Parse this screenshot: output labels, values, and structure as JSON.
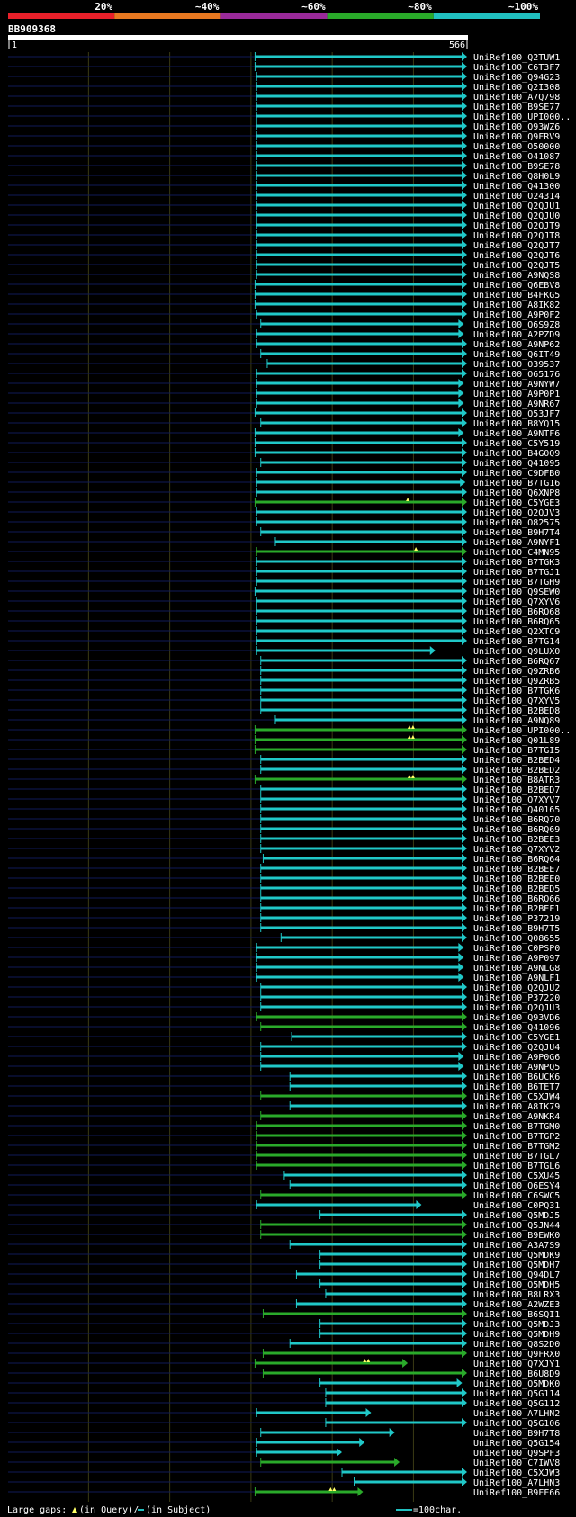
{
  "chart_data": {
    "type": "alignment-overview",
    "query_id": "BB909368",
    "query_range": [
      1,
      566
    ],
    "start_label": "1",
    "end_label": "566",
    "identity_scale": [
      {
        "label": "20%",
        "color": "#e8202a"
      },
      {
        "label": "~40%",
        "color": "#e87820"
      },
      {
        "label": "~60%",
        "color": "#9a2a9a"
      },
      {
        "label": "~80%",
        "color": "#2aaa2a"
      },
      {
        "label": "~100%",
        "color": "#20c0c0"
      }
    ],
    "hits": [
      {
        "id": "UniRef100_Q2TUW1",
        "start": 305,
        "end": 566,
        "c": "c"
      },
      {
        "id": "UniRef100_C6T3F7",
        "start": 305,
        "end": 566,
        "c": "c"
      },
      {
        "id": "UniRef100_Q94G23",
        "start": 307,
        "end": 566,
        "c": "c"
      },
      {
        "id": "UniRef100_Q2I308",
        "start": 307,
        "end": 566,
        "c": "c"
      },
      {
        "id": "UniRef100_A7Q798",
        "start": 307,
        "end": 566,
        "c": "c"
      },
      {
        "id": "UniRef100_B9SE77",
        "start": 307,
        "end": 566,
        "c": "c"
      },
      {
        "id": "UniRef100_UPI000..",
        "start": 307,
        "end": 566,
        "c": "c"
      },
      {
        "id": "UniRef100_Q93WZ6",
        "start": 307,
        "end": 566,
        "c": "c"
      },
      {
        "id": "UniRef100_Q9FRV9",
        "start": 307,
        "end": 566,
        "c": "c"
      },
      {
        "id": "UniRef100_O50000",
        "start": 307,
        "end": 566,
        "c": "c"
      },
      {
        "id": "UniRef100_O41087",
        "start": 307,
        "end": 566,
        "c": "c"
      },
      {
        "id": "UniRef100_B9SE78",
        "start": 307,
        "end": 566,
        "c": "c"
      },
      {
        "id": "UniRef100_Q8H0L9",
        "start": 307,
        "end": 566,
        "c": "c"
      },
      {
        "id": "UniRef100_Q41300",
        "start": 307,
        "end": 566,
        "c": "c"
      },
      {
        "id": "UniRef100_O24314",
        "start": 307,
        "end": 566,
        "c": "c"
      },
      {
        "id": "UniRef100_Q2QJU1",
        "start": 307,
        "end": 566,
        "c": "c"
      },
      {
        "id": "UniRef100_Q2QJU0",
        "start": 307,
        "end": 566,
        "c": "c"
      },
      {
        "id": "UniRef100_Q2QJT9",
        "start": 307,
        "end": 566,
        "c": "c"
      },
      {
        "id": "UniRef100_Q2QJT8",
        "start": 307,
        "end": 566,
        "c": "c"
      },
      {
        "id": "UniRef100_Q2QJT7",
        "start": 307,
        "end": 566,
        "c": "c"
      },
      {
        "id": "UniRef100_Q2QJT6",
        "start": 307,
        "end": 566,
        "c": "c"
      },
      {
        "id": "UniRef100_Q2QJT5",
        "start": 307,
        "end": 566,
        "c": "c"
      },
      {
        "id": "UniRef100_A9NQS8",
        "start": 307,
        "end": 566,
        "c": "c"
      },
      {
        "id": "UniRef100_Q6EBV8",
        "start": 305,
        "end": 566,
        "c": "c"
      },
      {
        "id": "UniRef100_B4FKG5",
        "start": 305,
        "end": 566,
        "c": "c"
      },
      {
        "id": "UniRef100_A8IK82",
        "start": 305,
        "end": 566,
        "c": "c"
      },
      {
        "id": "UniRef100_A9P0F2",
        "start": 307,
        "end": 566,
        "c": "c"
      },
      {
        "id": "UniRef100_Q6S9Z8",
        "start": 312,
        "end": 562,
        "c": "c"
      },
      {
        "id": "UniRef100_A2PZD9",
        "start": 307,
        "end": 562,
        "c": "c"
      },
      {
        "id": "UniRef100_A9NP62",
        "start": 307,
        "end": 566,
        "c": "c"
      },
      {
        "id": "UniRef100_Q6IT49",
        "start": 312,
        "end": 566,
        "c": "c"
      },
      {
        "id": "UniRef100_O39537",
        "start": 320,
        "end": 566,
        "c": "c"
      },
      {
        "id": "UniRef100_O65176",
        "start": 307,
        "end": 566,
        "c": "c"
      },
      {
        "id": "UniRef100_A9NYW7",
        "start": 307,
        "end": 562,
        "c": "c"
      },
      {
        "id": "UniRef100_A9P0P1",
        "start": 307,
        "end": 562,
        "c": "c"
      },
      {
        "id": "UniRef100_A9NR67",
        "start": 307,
        "end": 562,
        "c": "c"
      },
      {
        "id": "UniRef100_Q53JF7",
        "start": 305,
        "end": 566,
        "c": "c"
      },
      {
        "id": "UniRef100_B8YQ15",
        "start": 312,
        "end": 566,
        "c": "c"
      },
      {
        "id": "UniRef100_A9NTF6",
        "start": 305,
        "end": 562,
        "c": "c"
      },
      {
        "id": "UniRef100_C5Y519",
        "start": 305,
        "end": 566,
        "c": "c"
      },
      {
        "id": "UniRef100_B4G0Q9",
        "start": 305,
        "end": 566,
        "c": "c"
      },
      {
        "id": "UniRef100_Q41095",
        "start": 312,
        "end": 566,
        "c": "c"
      },
      {
        "id": "UniRef100_C9DFB0",
        "start": 307,
        "end": 566,
        "c": "c"
      },
      {
        "id": "UniRef100_B7TG16",
        "start": 307,
        "end": 564,
        "c": "c"
      },
      {
        "id": "UniRef100_Q6XNP8",
        "start": 307,
        "end": 566,
        "c": "c"
      },
      {
        "id": "UniRef100_C5YGE3",
        "start": 305,
        "end": 566,
        "c": "g",
        "gaps": [
          {
            "pos": 493,
            "count": 1
          }
        ]
      },
      {
        "id": "UniRef100_Q2QJV3",
        "start": 307,
        "end": 566,
        "c": "c"
      },
      {
        "id": "UniRef100_O82575",
        "start": 307,
        "end": 566,
        "c": "c"
      },
      {
        "id": "UniRef100_B9H7T4",
        "start": 312,
        "end": 566,
        "c": "c"
      },
      {
        "id": "UniRef100_A9NYF1",
        "start": 330,
        "end": 566,
        "c": "c"
      },
      {
        "id": "UniRef100_C4MN95",
        "start": 307,
        "end": 566,
        "c": "g",
        "gaps": [
          {
            "pos": 503,
            "count": 1
          }
        ]
      },
      {
        "id": "UniRef100_B7TGK3",
        "start": 307,
        "end": 566,
        "c": "c"
      },
      {
        "id": "UniRef100_B7TGJ1",
        "start": 307,
        "end": 566,
        "c": "c"
      },
      {
        "id": "UniRef100_B7TGH9",
        "start": 307,
        "end": 566,
        "c": "c"
      },
      {
        "id": "UniRef100_Q9SEW0",
        "start": 305,
        "end": 566,
        "c": "c"
      },
      {
        "id": "UniRef100_Q7XYV6",
        "start": 307,
        "end": 566,
        "c": "c"
      },
      {
        "id": "UniRef100_B6RQ68",
        "start": 307,
        "end": 566,
        "c": "c"
      },
      {
        "id": "UniRef100_B6RQ65",
        "start": 307,
        "end": 566,
        "c": "c"
      },
      {
        "id": "UniRef100_Q2XTC9",
        "start": 307,
        "end": 566,
        "c": "c"
      },
      {
        "id": "UniRef100_B7TG14",
        "start": 307,
        "end": 566,
        "c": "c"
      },
      {
        "id": "UniRef100_Q9LUX0",
        "start": 307,
        "end": 527,
        "c": "c"
      },
      {
        "id": "UniRef100_B6RQ67",
        "start": 312,
        "end": 566,
        "c": "c"
      },
      {
        "id": "UniRef100_Q9ZRB6",
        "start": 312,
        "end": 566,
        "c": "c"
      },
      {
        "id": "UniRef100_Q9ZRB5",
        "start": 312,
        "end": 566,
        "c": "c"
      },
      {
        "id": "UniRef100_B7TGK6",
        "start": 312,
        "end": 566,
        "c": "c"
      },
      {
        "id": "UniRef100_Q7XYV5",
        "start": 312,
        "end": 566,
        "c": "c"
      },
      {
        "id": "UniRef100_B2BED8",
        "start": 312,
        "end": 566,
        "c": "c"
      },
      {
        "id": "UniRef100_A9NQ89",
        "start": 330,
        "end": 566,
        "c": "c"
      },
      {
        "id": "UniRef100_UPI000..",
        "start": 305,
        "end": 566,
        "c": "g",
        "gaps": [
          {
            "pos": 495,
            "count": 2
          }
        ]
      },
      {
        "id": "UniRef100_Q01L89",
        "start": 305,
        "end": 566,
        "c": "g",
        "gaps": [
          {
            "pos": 495,
            "count": 2
          }
        ]
      },
      {
        "id": "UniRef100_B7TGI5",
        "start": 305,
        "end": 566,
        "c": "g"
      },
      {
        "id": "UniRef100_B2BED4",
        "start": 312,
        "end": 566,
        "c": "c"
      },
      {
        "id": "UniRef100_B2BED2",
        "start": 312,
        "end": 566,
        "c": "c"
      },
      {
        "id": "UniRef100_B8ATR3",
        "start": 305,
        "end": 566,
        "c": "g",
        "gaps": [
          {
            "pos": 495,
            "count": 2
          }
        ]
      },
      {
        "id": "UniRef100_B2BED7",
        "start": 312,
        "end": 566,
        "c": "c"
      },
      {
        "id": "UniRef100_Q7XYV7",
        "start": 312,
        "end": 566,
        "c": "c"
      },
      {
        "id": "UniRef100_Q40165",
        "start": 312,
        "end": 566,
        "c": "c"
      },
      {
        "id": "UniRef100_B6RQ70",
        "start": 312,
        "end": 566,
        "c": "c"
      },
      {
        "id": "UniRef100_B6RQ69",
        "start": 312,
        "end": 566,
        "c": "c"
      },
      {
        "id": "UniRef100_B2BEE3",
        "start": 312,
        "end": 566,
        "c": "c"
      },
      {
        "id": "UniRef100_Q7XYV2",
        "start": 312,
        "end": 566,
        "c": "c"
      },
      {
        "id": "UniRef100_B6RQ64",
        "start": 315,
        "end": 566,
        "c": "c"
      },
      {
        "id": "UniRef100_B2BEE7",
        "start": 312,
        "end": 566,
        "c": "c"
      },
      {
        "id": "UniRef100_B2BEE0",
        "start": 312,
        "end": 566,
        "c": "c"
      },
      {
        "id": "UniRef100_B2BED5",
        "start": 312,
        "end": 566,
        "c": "c"
      },
      {
        "id": "UniRef100_B6RQ66",
        "start": 312,
        "end": 566,
        "c": "c"
      },
      {
        "id": "UniRef100_B2BEF1",
        "start": 312,
        "end": 566,
        "c": "c"
      },
      {
        "id": "UniRef100_P37219",
        "start": 312,
        "end": 566,
        "c": "c"
      },
      {
        "id": "UniRef100_B9H7T5",
        "start": 312,
        "end": 566,
        "c": "c"
      },
      {
        "id": "UniRef100_Q08655",
        "start": 337,
        "end": 566,
        "c": "c"
      },
      {
        "id": "UniRef100_C0PSP0",
        "start": 307,
        "end": 562,
        "c": "c"
      },
      {
        "id": "UniRef100_A9P097",
        "start": 307,
        "end": 562,
        "c": "c"
      },
      {
        "id": "UniRef100_A9NLG8",
        "start": 307,
        "end": 562,
        "c": "c"
      },
      {
        "id": "UniRef100_A9NLF1",
        "start": 307,
        "end": 562,
        "c": "c"
      },
      {
        "id": "UniRef100_Q2QJU2",
        "start": 312,
        "end": 566,
        "c": "c"
      },
      {
        "id": "UniRef100_P37220",
        "start": 312,
        "end": 566,
        "c": "c"
      },
      {
        "id": "UniRef100_Q2QJU3",
        "start": 312,
        "end": 566,
        "c": "c"
      },
      {
        "id": "UniRef100_Q93VD6",
        "start": 307,
        "end": 566,
        "c": "g"
      },
      {
        "id": "UniRef100_Q41096",
        "start": 312,
        "end": 566,
        "c": "g"
      },
      {
        "id": "UniRef100_C5YGE1",
        "start": 350,
        "end": 566,
        "c": "c"
      },
      {
        "id": "UniRef100_Q2QJU4",
        "start": 312,
        "end": 566,
        "c": "c"
      },
      {
        "id": "UniRef100_A9P0G6",
        "start": 312,
        "end": 562,
        "c": "c"
      },
      {
        "id": "UniRef100_A9NPQ5",
        "start": 312,
        "end": 562,
        "c": "c"
      },
      {
        "id": "UniRef100_B6UCK6",
        "start": 348,
        "end": 566,
        "c": "c"
      },
      {
        "id": "UniRef100_B6TET7",
        "start": 348,
        "end": 566,
        "c": "c"
      },
      {
        "id": "UniRef100_C5XJW4",
        "start": 312,
        "end": 566,
        "c": "g"
      },
      {
        "id": "UniRef100_A8IK79",
        "start": 348,
        "end": 566,
        "c": "c"
      },
      {
        "id": "UniRef100_A9NKR4",
        "start": 312,
        "end": 566,
        "c": "g"
      },
      {
        "id": "UniRef100_B7TGM0",
        "start": 307,
        "end": 566,
        "c": "g"
      },
      {
        "id": "UniRef100_B7TGP2",
        "start": 307,
        "end": 566,
        "c": "g"
      },
      {
        "id": "UniRef100_B7TGM2",
        "start": 307,
        "end": 566,
        "c": "g"
      },
      {
        "id": "UniRef100_B7TGL7",
        "start": 307,
        "end": 566,
        "c": "g"
      },
      {
        "id": "UniRef100_B7TGL6",
        "start": 307,
        "end": 566,
        "c": "g"
      },
      {
        "id": "UniRef100_C5XU45",
        "start": 341,
        "end": 566,
        "c": "c"
      },
      {
        "id": "UniRef100_Q6ESY4",
        "start": 348,
        "end": 566,
        "c": "c"
      },
      {
        "id": "UniRef100_C6SWC5",
        "start": 312,
        "end": 566,
        "c": "g"
      },
      {
        "id": "UniRef100_C0PQ31",
        "start": 307,
        "end": 510,
        "c": "c"
      },
      {
        "id": "UniRef100_Q5MDJ5",
        "start": 385,
        "end": 566,
        "c": "c"
      },
      {
        "id": "UniRef100_Q5JN44",
        "start": 312,
        "end": 566,
        "c": "g"
      },
      {
        "id": "UniRef100_B9EWK0",
        "start": 312,
        "end": 566,
        "c": "g"
      },
      {
        "id": "UniRef100_A3A7S9",
        "start": 348,
        "end": 566,
        "c": "c"
      },
      {
        "id": "UniRef100_Q5MDK9",
        "start": 385,
        "end": 566,
        "c": "c"
      },
      {
        "id": "UniRef100_Q5MDH7",
        "start": 385,
        "end": 566,
        "c": "c"
      },
      {
        "id": "UniRef100_Q94DL7",
        "start": 356,
        "end": 566,
        "c": "c"
      },
      {
        "id": "UniRef100_Q5MDH5",
        "start": 385,
        "end": 566,
        "c": "c"
      },
      {
        "id": "UniRef100_B8LRX3",
        "start": 392,
        "end": 566,
        "c": "c"
      },
      {
        "id": "UniRef100_A2WZE3",
        "start": 356,
        "end": 566,
        "c": "c"
      },
      {
        "id": "UniRef100_B6SQI1",
        "start": 315,
        "end": 566,
        "c": "g"
      },
      {
        "id": "UniRef100_Q5MDJ3",
        "start": 385,
        "end": 566,
        "c": "c"
      },
      {
        "id": "UniRef100_Q5MDH9",
        "start": 385,
        "end": 566,
        "c": "c"
      },
      {
        "id": "UniRef100_Q8S2D0",
        "start": 348,
        "end": 566,
        "c": "c"
      },
      {
        "id": "UniRef100_Q9FRX0",
        "start": 315,
        "end": 566,
        "c": "g"
      },
      {
        "id": "UniRef100_Q7XJY1",
        "start": 305,
        "end": 493,
        "c": "g",
        "gaps": [
          {
            "pos": 440,
            "count": 2
          }
        ]
      },
      {
        "id": "UniRef100_B6U8D9",
        "start": 315,
        "end": 566,
        "c": "g"
      },
      {
        "id": "UniRef100_Q5MDK0",
        "start": 385,
        "end": 560,
        "c": "c"
      },
      {
        "id": "UniRef100_Q5G114",
        "start": 392,
        "end": 566,
        "c": "c"
      },
      {
        "id": "UniRef100_Q5G112",
        "start": 392,
        "end": 566,
        "c": "c"
      },
      {
        "id": "UniRef100_A7LHN2",
        "start": 307,
        "end": 448,
        "c": "c"
      },
      {
        "id": "UniRef100_Q5G106",
        "start": 392,
        "end": 566,
        "c": "c"
      },
      {
        "id": "UniRef100_B9H7T8",
        "start": 312,
        "end": 477,
        "c": "c"
      },
      {
        "id": "UniRef100_Q5G154",
        "start": 307,
        "end": 440,
        "c": "c"
      },
      {
        "id": "UniRef100_Q9SPF3",
        "start": 307,
        "end": 412,
        "c": "c"
      },
      {
        "id": "UniRef100_C7IWV8",
        "start": 312,
        "end": 483,
        "c": "g"
      },
      {
        "id": "UniRef100_C5XJW3",
        "start": 412,
        "end": 566,
        "c": "c"
      },
      {
        "id": "UniRef100_A7LHN3",
        "start": 427,
        "end": 566,
        "c": "c"
      },
      {
        "id": "UniRef100_B9FF66",
        "start": 305,
        "end": 438,
        "c": "g",
        "gaps": [
          {
            "pos": 398,
            "count": 2
          }
        ]
      }
    ],
    "footer": {
      "gaps_label": "Large gaps:",
      "query_gap_label": "(in Query)/",
      "subject_gap_label": "(in Subject)",
      "scale_label": "=100char."
    }
  }
}
